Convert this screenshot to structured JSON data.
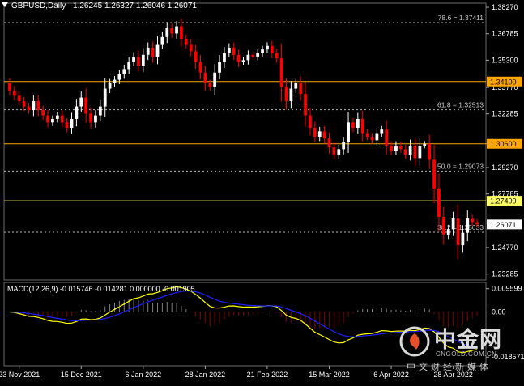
{
  "header": {
    "symbol": "GBPUSD,Daily",
    "ohlc": "1.26245 1.26327 1.26046 1.26071"
  },
  "macd_header": "MACD(12,26,9) -0.015746 -0.014281 0.000000 -0.001905",
  "colors": {
    "background": "#000000",
    "bull_candle": "#ffffff",
    "bear_candle": "#ff0000",
    "fib_line": "#b4b4b4",
    "level_line": "#ffa500",
    "level_line_yellow": "#ffff66",
    "macd_main": "#ffff00",
    "macd_signal": "#2020ff",
    "macd_hist_pos": "#ffffff",
    "macd_hist_neg": "#ff0000",
    "grid": "#404040"
  },
  "chart_data": {
    "type": "candlestick",
    "price_axis_ticks": [
      "1.38270",
      "1.36785",
      "1.35300",
      "1.33770",
      "1.32285",
      "1.30600",
      "1.29270",
      "1.27785",
      "1.26071",
      "1.24770",
      "1.23285"
    ],
    "time_axis_labels": [
      "23 Nov 2021",
      "15 Dec 2021",
      "6 Jan 2022",
      "28 Jan 2022",
      "21 Feb 2022",
      "15 Mar 2022",
      "6 Apr 2022",
      "28 Apr 2022"
    ],
    "fib_levels": [
      {
        "label": "78.6 = 1.37411",
        "price": 1.37411
      },
      {
        "label": "61.8 = 1.32513",
        "price": 1.32513
      },
      {
        "label": "50.0 = 1.29073",
        "price": 1.29073
      },
      {
        "label": "38.2 = 1.25633",
        "price": 1.25633
      }
    ],
    "horizontal_levels": [
      {
        "label": "1.34100",
        "price": 1.341
      },
      {
        "label": "1.30600",
        "price": 1.306
      },
      {
        "label": "1.27400",
        "price": 1.274
      }
    ],
    "current_price": "1.26071",
    "closes": [
      1.336,
      1.333,
      1.33,
      1.327,
      1.325,
      1.33,
      1.325,
      1.322,
      1.318,
      1.32,
      1.322,
      1.318,
      1.315,
      1.32,
      1.327,
      1.332,
      1.323,
      1.318,
      1.322,
      1.327,
      1.337,
      1.34,
      1.342,
      1.345,
      1.348,
      1.352,
      1.355,
      1.35,
      1.356,
      1.36,
      1.355,
      1.362,
      1.366,
      1.371,
      1.368,
      1.372,
      1.365,
      1.362,
      1.358,
      1.352,
      1.346,
      1.34,
      1.338,
      1.346,
      1.352,
      1.357,
      1.36,
      1.356,
      1.352,
      1.353,
      1.356,
      1.355,
      1.357,
      1.359,
      1.361,
      1.357,
      1.354,
      1.338,
      1.33,
      1.337,
      1.34,
      1.334,
      1.322,
      1.315,
      1.31,
      1.313,
      1.309,
      1.304,
      1.3,
      1.303,
      1.307,
      1.318,
      1.315,
      1.32,
      1.312,
      1.31,
      1.308,
      1.312,
      1.314,
      1.305,
      1.302,
      1.305,
      1.303,
      1.3,
      1.305,
      1.298,
      1.305,
      1.306,
      1.297,
      1.281,
      1.265,
      1.255,
      1.258,
      1.264,
      1.249,
      1.256,
      1.264,
      1.262,
      1.2607
    ],
    "macd_ticks": [
      "0.009599",
      "0.00",
      "-0.018571"
    ]
  },
  "watermark": {
    "brand": "中金网",
    "url": "CNGOLD.COM.CN",
    "tagline": "中文财经新媒体"
  }
}
